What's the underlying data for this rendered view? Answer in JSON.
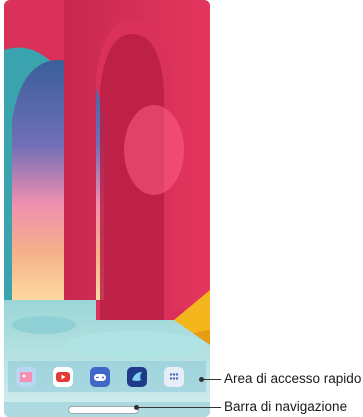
{
  "screen": {
    "wallpaper": "pink-arches-sky-wallpaper"
  },
  "dock": {
    "apps": [
      {
        "name": "gallery",
        "icon": "gallery-icon",
        "color": "#9ec6e8"
      },
      {
        "name": "youtube",
        "icon": "youtube-icon",
        "color": "#e53935"
      },
      {
        "name": "game-launcher",
        "icon": "gamepad-icon",
        "color": "#3f68c8"
      },
      {
        "name": "app",
        "icon": "bird-icon",
        "color": "#1f3a8a"
      },
      {
        "name": "apps-drawer",
        "icon": "app-drawer-icon",
        "color": "#7d95c9"
      }
    ]
  },
  "callouts": {
    "quick_access": "Area di accesso rapido",
    "navigation_bar": "Barra di navigazione"
  }
}
